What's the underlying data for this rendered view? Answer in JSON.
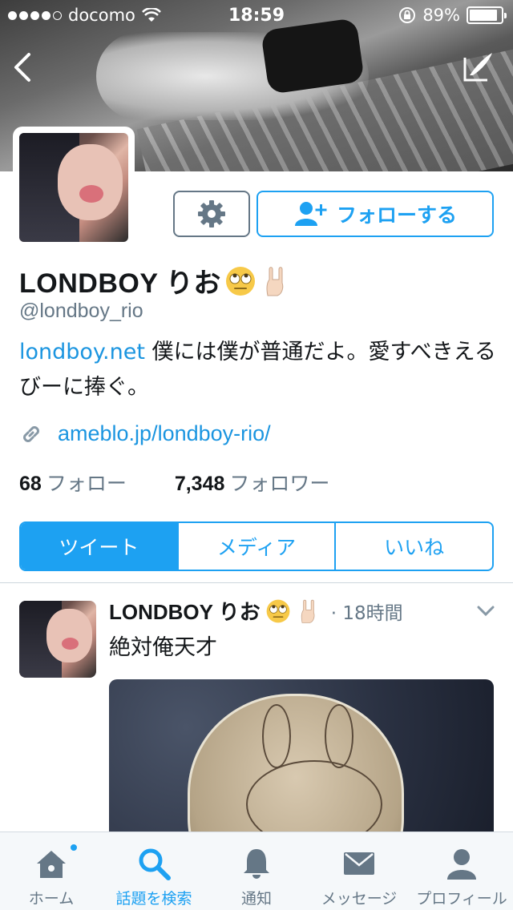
{
  "status_bar": {
    "carrier": "docomo",
    "time": "18:59",
    "battery": "89%",
    "battery_level": 0.89
  },
  "profile": {
    "name": "LONDBOY りお",
    "handle": "@londboy_rio",
    "bio_link": "londboy.net",
    "bio_text": " 僕には僕が普通だよ。愛すべきえるびーに捧ぐ。",
    "website": "ameblo.jp/londboy-rio/",
    "following_count": "68",
    "following_label": "フォロー",
    "followers_count": "7,348",
    "followers_label": "フォロワー"
  },
  "actions": {
    "follow_label": "フォローする"
  },
  "tabs": [
    {
      "label": "ツイート",
      "active": true
    },
    {
      "label": "メディア",
      "active": false
    },
    {
      "label": "いいね",
      "active": false
    }
  ],
  "tweet": {
    "name": "LONDBOY りお",
    "time": "· 18時間",
    "text": "絶対俺天才"
  },
  "bottom_nav": [
    {
      "label": "ホーム",
      "icon": "home-icon",
      "active": false
    },
    {
      "label": "話題を検索",
      "icon": "search-icon",
      "active": true
    },
    {
      "label": "通知",
      "icon": "bell-icon",
      "active": false
    },
    {
      "label": "メッセージ",
      "icon": "mail-icon",
      "active": false
    },
    {
      "label": "プロフィール",
      "icon": "person-icon",
      "active": false
    }
  ],
  "colors": {
    "accent": "#1da1f2",
    "link": "#1b95e0",
    "muted": "#657786"
  }
}
